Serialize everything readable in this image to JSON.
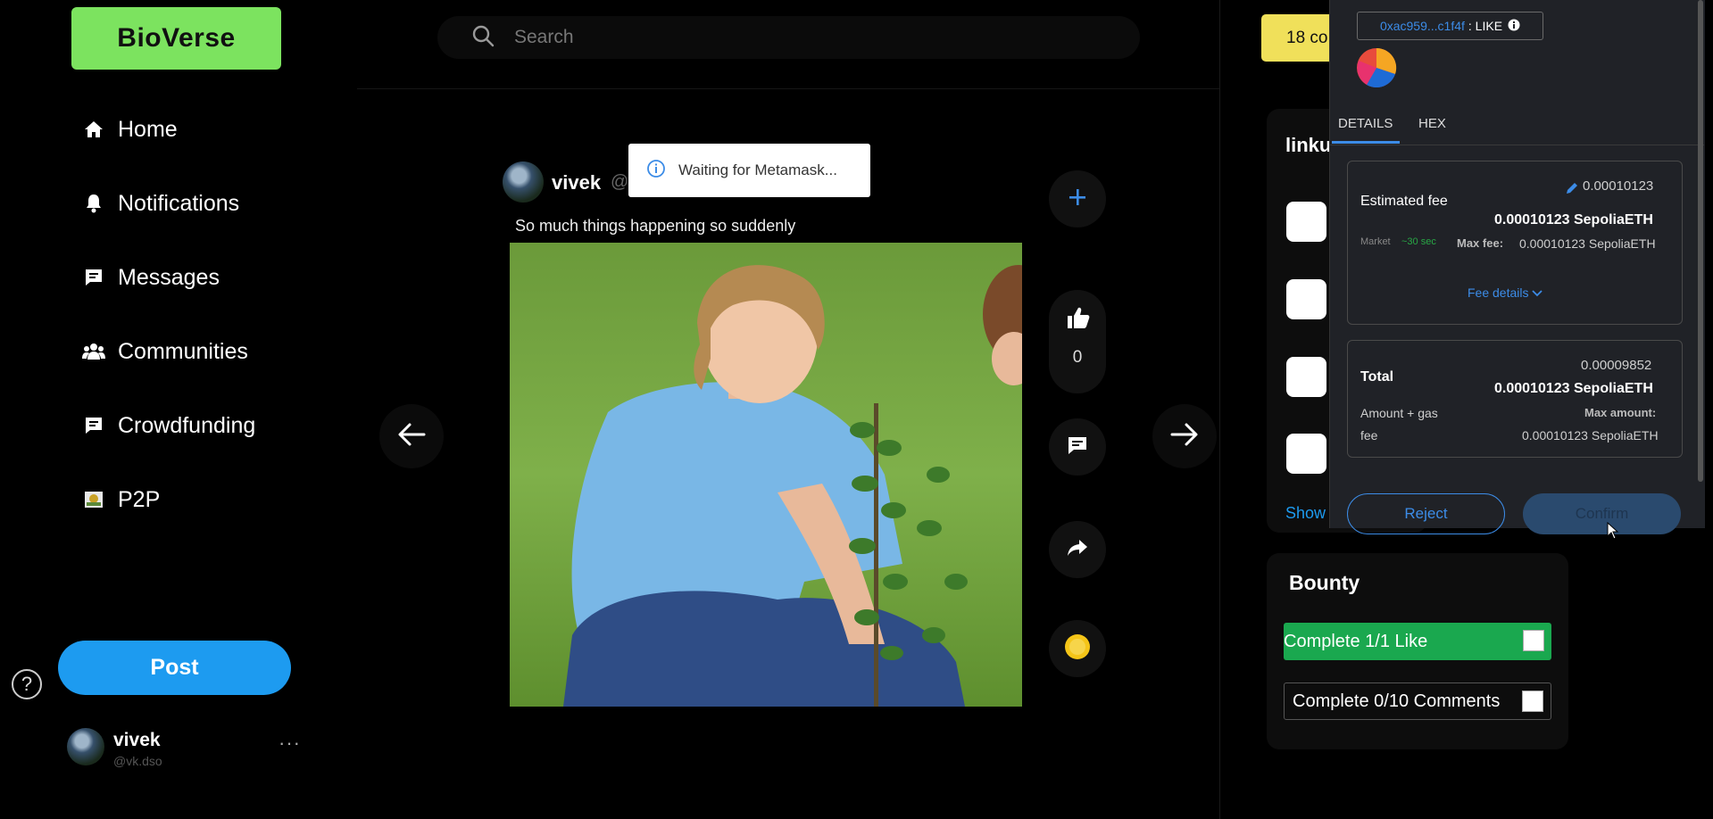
{
  "app": {
    "logo": "BioVerse"
  },
  "sidebar": {
    "items": [
      {
        "label": "Home",
        "icon": "home-icon"
      },
      {
        "label": "Notifications",
        "icon": "bell-icon"
      },
      {
        "label": "Messages",
        "icon": "message-icon"
      },
      {
        "label": "Communities",
        "icon": "users-icon"
      },
      {
        "label": "Crowdfunding",
        "icon": "message-icon"
      },
      {
        "label": "P2P",
        "icon": "image-icon"
      }
    ],
    "post_label": "Post",
    "help_label": "?",
    "user": {
      "name": "vivek",
      "handle": "@vk.dso"
    },
    "more_label": "···"
  },
  "search": {
    "placeholder": "Search"
  },
  "post": {
    "author": "vivek",
    "handle_partial": "@",
    "text": "So much things happening so suddenly",
    "likes": "0",
    "toast": "Waiting for Metamask..."
  },
  "right": {
    "coins_partial": "18 co",
    "trending_title_partial": "linku",
    "show_more_partial": "Show",
    "bounty": {
      "title": "Bounty",
      "items": [
        {
          "label": "Complete 1/1 Like",
          "done": true
        },
        {
          "label": "Complete 0/10 Comments",
          "done": false
        }
      ]
    }
  },
  "metamask": {
    "address": "0xac959...c1f4f",
    "method": ": LIKE",
    "tabs": [
      "DETAILS",
      "HEX"
    ],
    "active_tab": "DETAILS",
    "estimated_fee_label": "Estimated fee",
    "estimated_fee_eth": "0.00010123",
    "estimated_fee_main": "0.00010123 SepoliaETH",
    "market_label": "Market",
    "market_time": "~30 sec",
    "max_fee_label": "Max fee:",
    "max_fee_value": "0.00010123 SepoliaETH",
    "fee_details_label": "Fee details",
    "total_label": "Total",
    "total_eth": "0.00009852",
    "total_main": "0.00010123 SepoliaETH",
    "amount_gas_label_1": "Amount + gas",
    "amount_gas_label_2": "fee",
    "max_amount_label": "Max amount:",
    "max_amount_value": "0.00010123 SepoliaETH",
    "reject_label": "Reject",
    "confirm_label": "Confirm",
    "accent_color": "#3c8ce7"
  }
}
